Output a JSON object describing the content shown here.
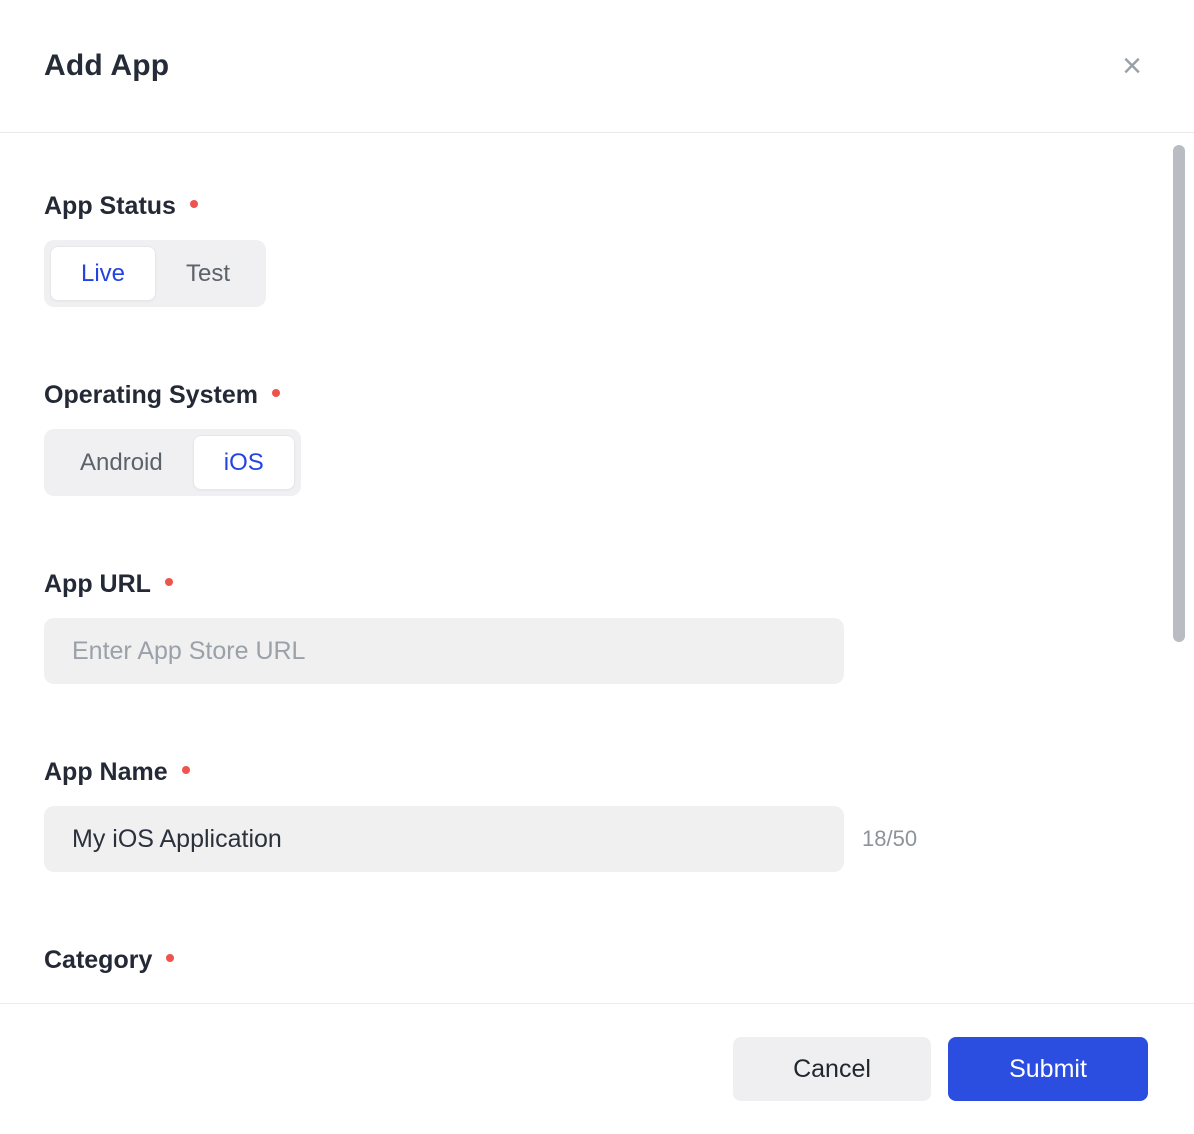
{
  "modal": {
    "title": "Add App",
    "close_icon": "×"
  },
  "form": {
    "app_status": {
      "label": "App Status",
      "required": true,
      "options": [
        "Live",
        "Test"
      ],
      "selected": "Live"
    },
    "operating_system": {
      "label": "Operating System",
      "required": true,
      "options": [
        "Android",
        "iOS"
      ],
      "selected": "iOS"
    },
    "app_url": {
      "label": "App URL",
      "required": true,
      "placeholder": "Enter App Store URL",
      "value": ""
    },
    "app_name": {
      "label": "App Name",
      "required": true,
      "value": "My iOS Application",
      "counter": "18/50"
    },
    "category": {
      "label": "Category",
      "required": true
    }
  },
  "footer": {
    "cancel_label": "Cancel",
    "submit_label": "Submit"
  },
  "colors": {
    "accent_blue": "#2b4de0",
    "selected_text_blue": "#2443df",
    "required_dot_red": "#ee544d",
    "input_background": "#f0f0f1",
    "toggle_background": "#f0f0f2"
  }
}
